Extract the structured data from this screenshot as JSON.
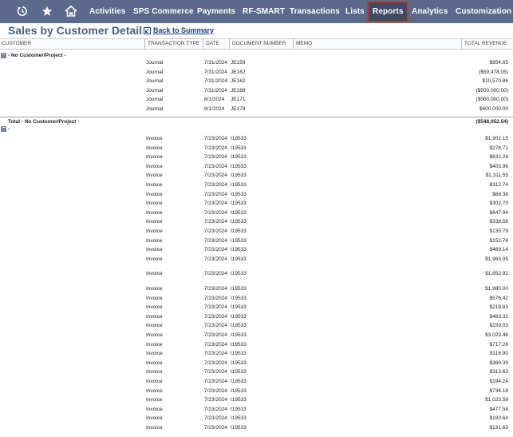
{
  "nav": {
    "items": [
      {
        "label": "Activities"
      },
      {
        "label": "SPS Commerce"
      },
      {
        "label": "Payments"
      },
      {
        "label": "RF-SMART"
      },
      {
        "label": "Transactions"
      },
      {
        "label": "Lists"
      },
      {
        "label": "Reports"
      },
      {
        "label": "Analytics"
      },
      {
        "label": "Customization"
      }
    ],
    "active": "Reports",
    "icons": [
      "recent-records-icon",
      "star-icon",
      "home-icon"
    ]
  },
  "page": {
    "title": "Sales by Customer Detail",
    "back_link": "Back to Summary"
  },
  "table": {
    "headers": {
      "customer": "CUSTOMER",
      "transaction_type": "TRANSACTION TYPE",
      "date": "DATE",
      "document_number": "DOCUMENT NUMBER",
      "memo": "MEMO",
      "total_revenue": "TOTAL REVENUE"
    },
    "group1": {
      "label": "- No Customer/Project -",
      "rows": [
        {
          "type": "Journal",
          "date": "7/31/2024",
          "doc": "JE159",
          "amount": "$854.65"
        },
        {
          "type": "Journal",
          "date": "7/31/2024",
          "doc": "JE162",
          "amount": "($59,478.05)"
        },
        {
          "type": "Journal",
          "date": "7/31/2024",
          "doc": "JE162",
          "amount": "$10,570.86"
        },
        {
          "type": "Journal",
          "date": "7/31/2024",
          "doc": "JE168",
          "amount": "($500,000.00)"
        },
        {
          "type": "Journal",
          "date": "8/1/2024",
          "doc": "JE171",
          "amount": "($500,000.00)"
        },
        {
          "type": "Journal",
          "date": "8/1/2024",
          "doc": "JE178",
          "amount": "$600,000.00"
        }
      ],
      "total_label": "Total - No Customer/Project -",
      "total_amount": "($548,052.54)"
    },
    "group2": {
      "label": "-",
      "rows": [
        {
          "type": "Invoice",
          "date": "7/23/2024",
          "doc": "I19533",
          "amount": "$1,902.15"
        },
        {
          "type": "Invoice",
          "date": "7/23/2024",
          "doc": "I19533",
          "amount": "$278.71"
        },
        {
          "type": "Invoice",
          "date": "7/23/2024",
          "doc": "I19533",
          "amount": "$632.28"
        },
        {
          "type": "Invoice",
          "date": "7/23/2024",
          "doc": "I19533",
          "amount": "$403.96"
        },
        {
          "type": "Invoice",
          "date": "7/23/2024",
          "doc": "I19533",
          "amount": "$1,311.55"
        },
        {
          "type": "Invoice",
          "date": "7/23/2024",
          "doc": "I19533",
          "amount": "$312.74"
        },
        {
          "type": "Invoice",
          "date": "7/23/2024",
          "doc": "I19533",
          "amount": "$69.38"
        },
        {
          "type": "Invoice",
          "date": "7/23/2024",
          "doc": "I19533",
          "amount": "$302.70"
        },
        {
          "type": "Invoice",
          "date": "7/23/2024",
          "doc": "I19533",
          "amount": "$647.94"
        },
        {
          "type": "Invoice",
          "date": "7/23/2024",
          "doc": "I19533",
          "amount": "$338.58"
        },
        {
          "type": "Invoice",
          "date": "7/23/2024",
          "doc": "I19533",
          "amount": "$135.79"
        },
        {
          "type": "Invoice",
          "date": "7/23/2024",
          "doc": "I19533",
          "amount": "$152.78"
        },
        {
          "type": "Invoice",
          "date": "7/23/2024",
          "doc": "I19533",
          "amount": "$469.14"
        },
        {
          "type": "Invoice",
          "date": "7/23/2024",
          "doc": "I19533",
          "amount": "$1,963.05"
        },
        {
          "type": "Invoice",
          "date": "7/23/2024",
          "doc": "I19533",
          "amount": "$1,852.92",
          "tall": true
        },
        {
          "type": "Invoice",
          "date": "7/23/2024",
          "doc": "I19533",
          "amount": "$1,980.00",
          "tall": true
        },
        {
          "type": "Invoice",
          "date": "7/23/2024",
          "doc": "I19533",
          "amount": "$576.42"
        },
        {
          "type": "Invoice",
          "date": "7/23/2024",
          "doc": "I19533",
          "amount": "$218.83"
        },
        {
          "type": "Invoice",
          "date": "7/23/2024",
          "doc": "I19533",
          "amount": "$463.32"
        },
        {
          "type": "Invoice",
          "date": "7/23/2024",
          "doc": "I19533",
          "amount": "$159.03"
        },
        {
          "type": "Invoice",
          "date": "7/23/2024",
          "doc": "I19533",
          "amount": "$3,023.46"
        },
        {
          "type": "Invoice",
          "date": "7/23/2024",
          "doc": "I19533",
          "amount": "$717.26"
        },
        {
          "type": "Invoice",
          "date": "7/23/2024",
          "doc": "I19533",
          "amount": "$116.90"
        },
        {
          "type": "Invoice",
          "date": "7/23/2024",
          "doc": "I19533",
          "amount": "$369.39"
        },
        {
          "type": "Invoice",
          "date": "7/23/2024",
          "doc": "I19533",
          "amount": "$313.63"
        },
        {
          "type": "Invoice",
          "date": "7/23/2024",
          "doc": "I19533",
          "amount": "$194.24"
        },
        {
          "type": "Invoice",
          "date": "7/23/2024",
          "doc": "I19533",
          "amount": "$734.18"
        },
        {
          "type": "Invoice",
          "date": "7/23/2024",
          "doc": "I19533",
          "amount": "$1,023.58"
        },
        {
          "type": "Invoice",
          "date": "7/23/2024",
          "doc": "I19533",
          "amount": "$477.58"
        },
        {
          "type": "Invoice",
          "date": "7/23/2024",
          "doc": "I19533",
          "amount": "$193.64"
        },
        {
          "type": "Invoice",
          "date": "7/23/2024",
          "doc": "I19533",
          "amount": "$131.63"
        }
      ]
    }
  },
  "colors": {
    "nav_bg": "#5b6a8c",
    "nav_active_bg": "#3e4a66",
    "nav_active_border": "#d6341e",
    "title": "#4d5f7d"
  }
}
